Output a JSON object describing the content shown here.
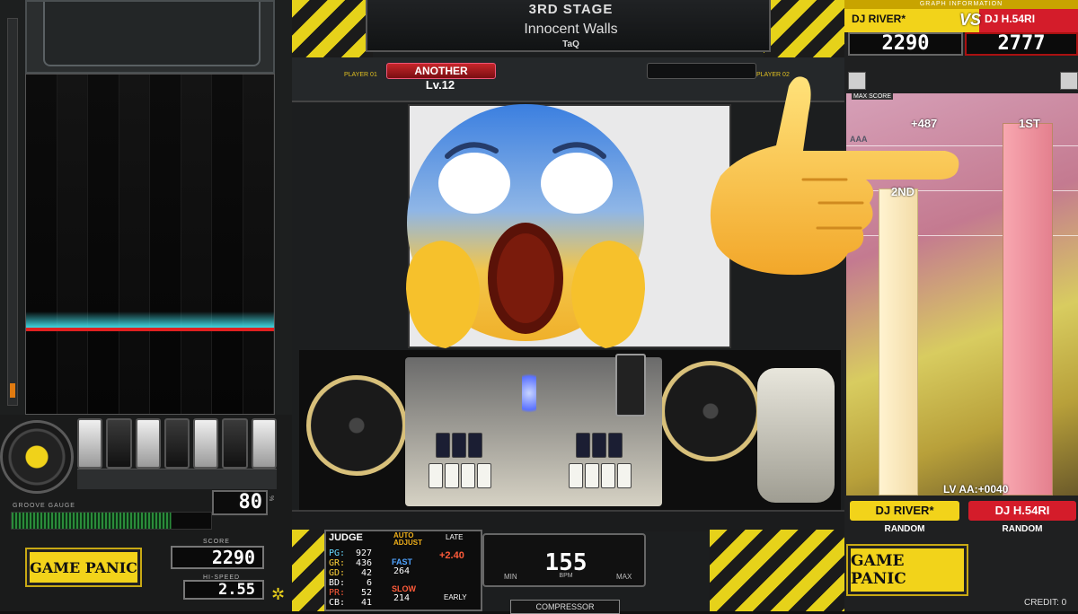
{
  "left": {
    "groove_gauge_label": "GROOVE GAUGE",
    "gauge_value": "80",
    "gauge_unit": "%",
    "gauge_fill": 0.8,
    "logo": "GAME PANIC",
    "score_label": "SCORE",
    "score": "2290",
    "hispeed_label": "HI-SPEED",
    "hispeed": "2.55"
  },
  "stage": {
    "stage_label": "3RD STAGE",
    "song_title": "Innocent Walls",
    "artist": "TaQ",
    "player1_label": "PLAYER 01",
    "player2_label": "PLAYER 02",
    "difficulty": "ANOTHER",
    "level": "Lv.12"
  },
  "judge": {
    "title": "JUDGE",
    "auto_adjust": "AUTO ADJUST",
    "late_label": "LATE",
    "early_label": "EARLY",
    "offset": "+2.40",
    "rows": [
      {
        "label": "PG:",
        "value": "927",
        "color": "#66d9ff"
      },
      {
        "label": "GR:",
        "value": "436",
        "color": "#ffd23a"
      },
      {
        "label": "GD:",
        "value": "42",
        "color": "#ffd23a"
      },
      {
        "label": "BD:",
        "value": "6",
        "color": "#ffffff"
      },
      {
        "label": "PR:",
        "value": "52",
        "color": "#ff5b3a"
      },
      {
        "label": "CB:",
        "value": "41",
        "color": "#ffffff"
      }
    ],
    "fast_label": "FAST",
    "fast_value": "264",
    "slow_label": "SLOW",
    "slow_value": "214"
  },
  "bpm": {
    "value": "155",
    "label": "BPM",
    "min_label": "MIN",
    "max_label": "MAX"
  },
  "effect": "COMPRESSOR",
  "right": {
    "graph_info": "GRAPH INFORMATION",
    "rival_a": "DJ RIVER*",
    "vs": "VS",
    "rival_b": "DJ H.54RI",
    "score_a": "2290",
    "score_b": "2777",
    "max_score_label": "MAX SCORE",
    "diff_label": "+487",
    "aaa_label": "AAA",
    "rank_a": "2ND",
    "rank_b": "1ST",
    "lv_aa": "LV AA:+0040",
    "option_a": "RANDOM",
    "option_b": "RANDOM",
    "logo": "GAME PANIC",
    "credit": "CREDIT: 0"
  },
  "colors": {
    "accent_yellow": "#f2d31a",
    "rival_red": "#d41c2a",
    "lane_glow": "#3fd6e0"
  }
}
